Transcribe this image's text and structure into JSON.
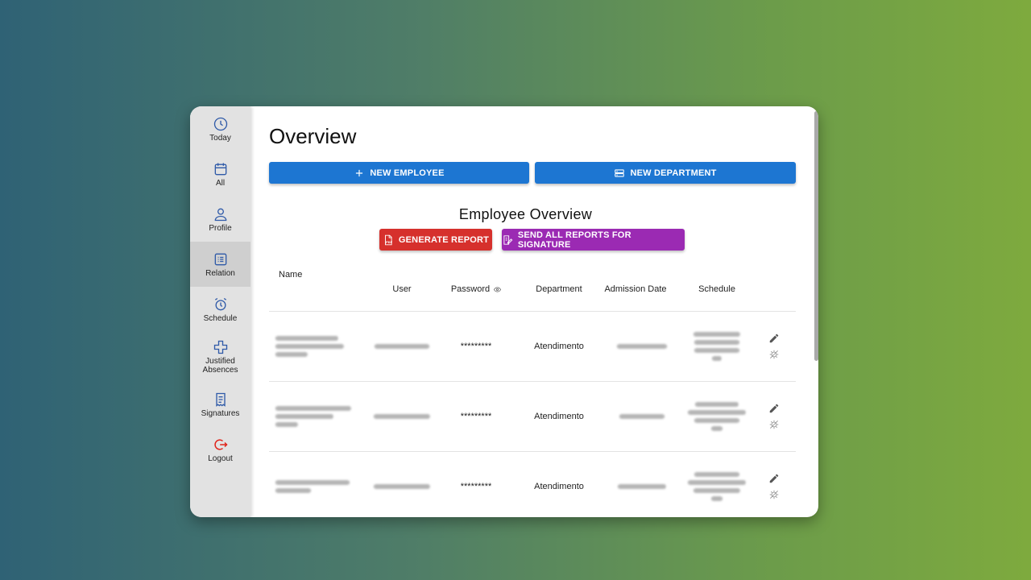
{
  "sidebar": {
    "items": [
      {
        "label": "Today",
        "icon": "clock-icon"
      },
      {
        "label": "All",
        "icon": "calendar-icon"
      },
      {
        "label": "Profile",
        "icon": "person-icon"
      },
      {
        "label": "Relation",
        "icon": "list-icon"
      },
      {
        "label": "Schedule",
        "icon": "alarm-icon"
      },
      {
        "label": "Justified Absences",
        "icon": "plus-icon"
      },
      {
        "label": "Signatures",
        "icon": "receipt-icon"
      },
      {
        "label": "Logout",
        "icon": "logout-icon"
      }
    ],
    "active_index": 3
  },
  "main": {
    "title": "Overview",
    "new_employee_label": "NEW EMPLOYEE",
    "new_department_label": "NEW DEPARTMENT",
    "section_title": "Employee Overview",
    "generate_report_label": "GENERATE REPORT",
    "send_reports_label": "SEND ALL REPORTS FOR SIGNATURE"
  },
  "table": {
    "headers": {
      "name": "Name",
      "user": "User",
      "password": "Password",
      "department": "Department",
      "admission_date": "Admission Date",
      "schedule": "Schedule"
    },
    "rows": [
      {
        "password": "*********",
        "department": "Atendimento"
      },
      {
        "password": "*********",
        "department": "Atendimento"
      },
      {
        "password": "*********",
        "department": "Atendimento"
      }
    ]
  },
  "colors": {
    "primary": "#1d76d2",
    "danger": "#d6302c",
    "accent": "#9b2ab3",
    "logout": "#e0241b",
    "nav_icon": "#2f5aa8"
  }
}
